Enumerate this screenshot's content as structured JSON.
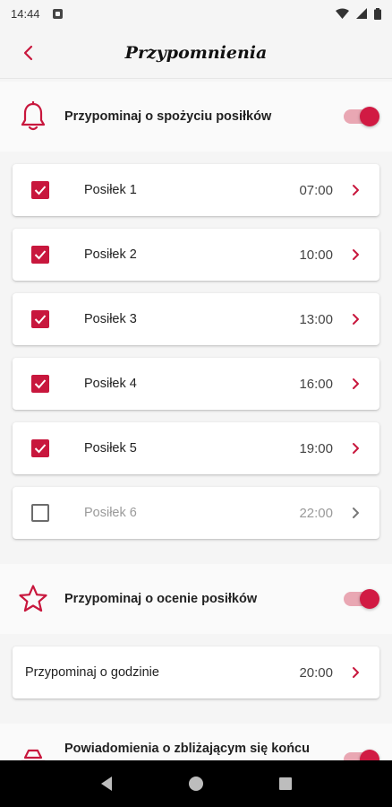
{
  "status": {
    "time": "14:44"
  },
  "header": {
    "title": "Przypomnienia"
  },
  "meal_reminder": {
    "label": "Przypominaj o spożyciu posiłków",
    "enabled": true,
    "meals": [
      {
        "label": "Posiłek 1",
        "time": "07:00",
        "checked": true
      },
      {
        "label": "Posiłek 2",
        "time": "10:00",
        "checked": true
      },
      {
        "label": "Posiłek 3",
        "time": "13:00",
        "checked": true
      },
      {
        "label": "Posiłek 4",
        "time": "16:00",
        "checked": true
      },
      {
        "label": "Posiłek 5",
        "time": "19:00",
        "checked": true
      },
      {
        "label": "Posiłek 6",
        "time": "22:00",
        "checked": false
      }
    ]
  },
  "rating_reminder": {
    "label": "Przypominaj o ocenie posiłków",
    "enabled": true,
    "time_row": {
      "label": "Przypominaj o godzinie",
      "time": "20:00"
    }
  },
  "end_notification": {
    "label": "Powiadomienia o zbliżającym się końcu",
    "enabled": true
  },
  "colors": {
    "accent": "#c8173d",
    "toggle_track": "#e9a7b3"
  }
}
